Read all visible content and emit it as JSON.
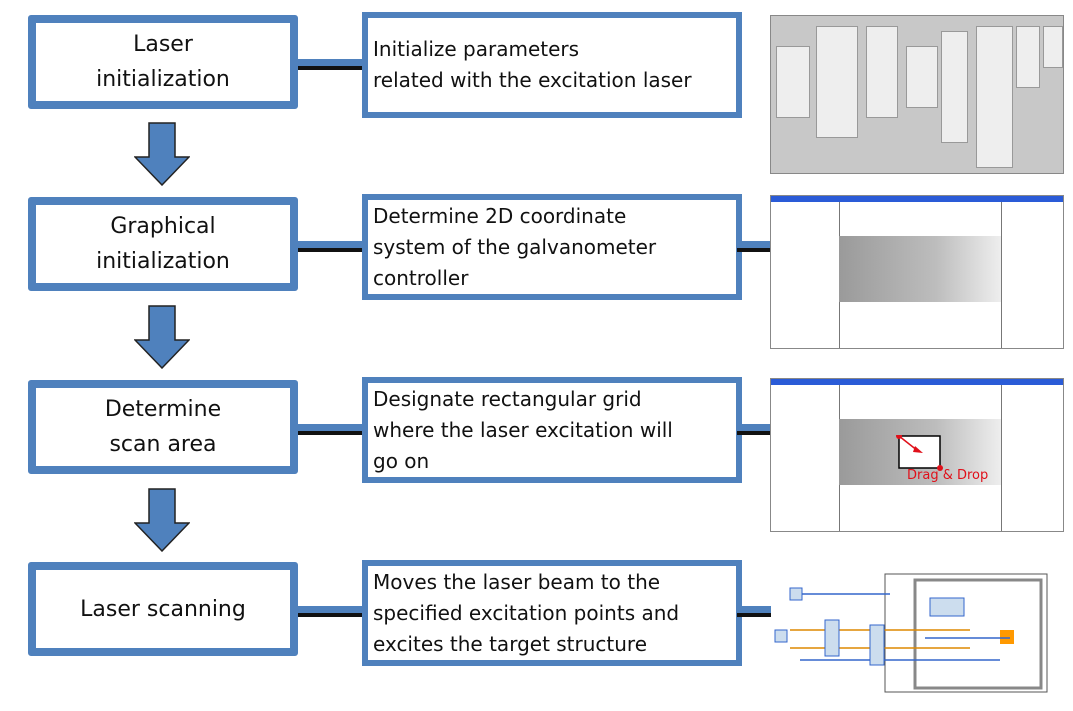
{
  "steps": [
    {
      "title": "Laser\ninitialization",
      "description": "Initialize parameters\nrelated with the excitation laser"
    },
    {
      "title": "Graphical\ninitialization",
      "description": "Determine 2D coordinate\nsystem of the galvanometer\ncontroller"
    },
    {
      "title": "Determine\nscan area",
      "description": "Designate rectangular grid\nwhere the laser excitation will\ngo on"
    },
    {
      "title": "Laser scanning",
      "description": "Moves the laser beam to the\nspecified excitation points and\nexcites the target structure"
    }
  ],
  "annotation": "Drag & Drop",
  "colors": {
    "box_border": "#4f81bd",
    "annotation": "#e0101a"
  }
}
